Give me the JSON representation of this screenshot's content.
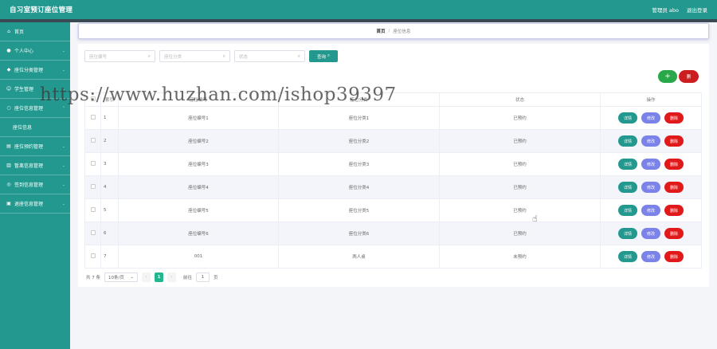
{
  "header": {
    "app_title": "自习室预订座位管理",
    "user_label": "管理员 abo",
    "logout_label": "退出登录"
  },
  "sidebar": {
    "items": [
      {
        "label": "首页",
        "icon": "home-icon"
      },
      {
        "label": "个人中心",
        "icon": "user-icon"
      },
      {
        "label": "座位分类管理",
        "icon": "category-icon"
      },
      {
        "label": "学生管理",
        "icon": "student-icon"
      },
      {
        "label": "座位信息管理",
        "icon": "seat-icon"
      }
    ],
    "sub_item": {
      "label": "座位信息"
    },
    "items2": [
      {
        "label": "座位预约管理",
        "icon": "calendar-icon"
      },
      {
        "label": "暂离信息管理",
        "icon": "pause-icon"
      },
      {
        "label": "签到信息管理",
        "icon": "checkin-icon"
      },
      {
        "label": "退座信息管理",
        "icon": "exit-icon"
      }
    ]
  },
  "breadcrumb": {
    "home": "首页",
    "separator": "/",
    "current": "座位信息"
  },
  "search": {
    "seat_no_placeholder": "座位编号",
    "category_placeholder": "座位分类",
    "status_placeholder": "状态",
    "query_label": "查询",
    "search_icon": "magnifier-icon"
  },
  "actions": {
    "add_label": "+",
    "delete_label": "删"
  },
  "table": {
    "headers": [
      "",
      "索引",
      "座位编号",
      "座位分类",
      "状态",
      "操作"
    ],
    "rows": [
      {
        "idx": "1",
        "seat_no": "座位编号1",
        "category": "座位分类1",
        "status": "已预约"
      },
      {
        "idx": "2",
        "seat_no": "座位编号2",
        "category": "座位分类2",
        "status": "已预约"
      },
      {
        "idx": "3",
        "seat_no": "座位编号3",
        "category": "座位分类3",
        "status": "已预约"
      },
      {
        "idx": "4",
        "seat_no": "座位编号4",
        "category": "座位分类4",
        "status": "已预约"
      },
      {
        "idx": "5",
        "seat_no": "座位编号5",
        "category": "座位分类5",
        "status": "已预约"
      },
      {
        "idx": "6",
        "seat_no": "座位编号6",
        "category": "座位分类6",
        "status": "已预约"
      },
      {
        "idx": "7",
        "seat_no": "001",
        "category": "两人桌",
        "status": "未预约"
      }
    ],
    "op_detail": "详情",
    "op_edit": "修改",
    "op_delete": "删除"
  },
  "pagination": {
    "total_label": "共 7 条",
    "page_size": "10条/页",
    "prev": "‹",
    "current_page": "1",
    "next": "›",
    "goto_label": "前往",
    "goto_value": "1",
    "page_suffix": "页"
  },
  "watermark": "https://www.huzhan.com/ishop39397",
  "colors": {
    "primary": "#22988f",
    "edit": "#7b83e8",
    "danger": "#e01a1a",
    "add": "#29a84a"
  }
}
